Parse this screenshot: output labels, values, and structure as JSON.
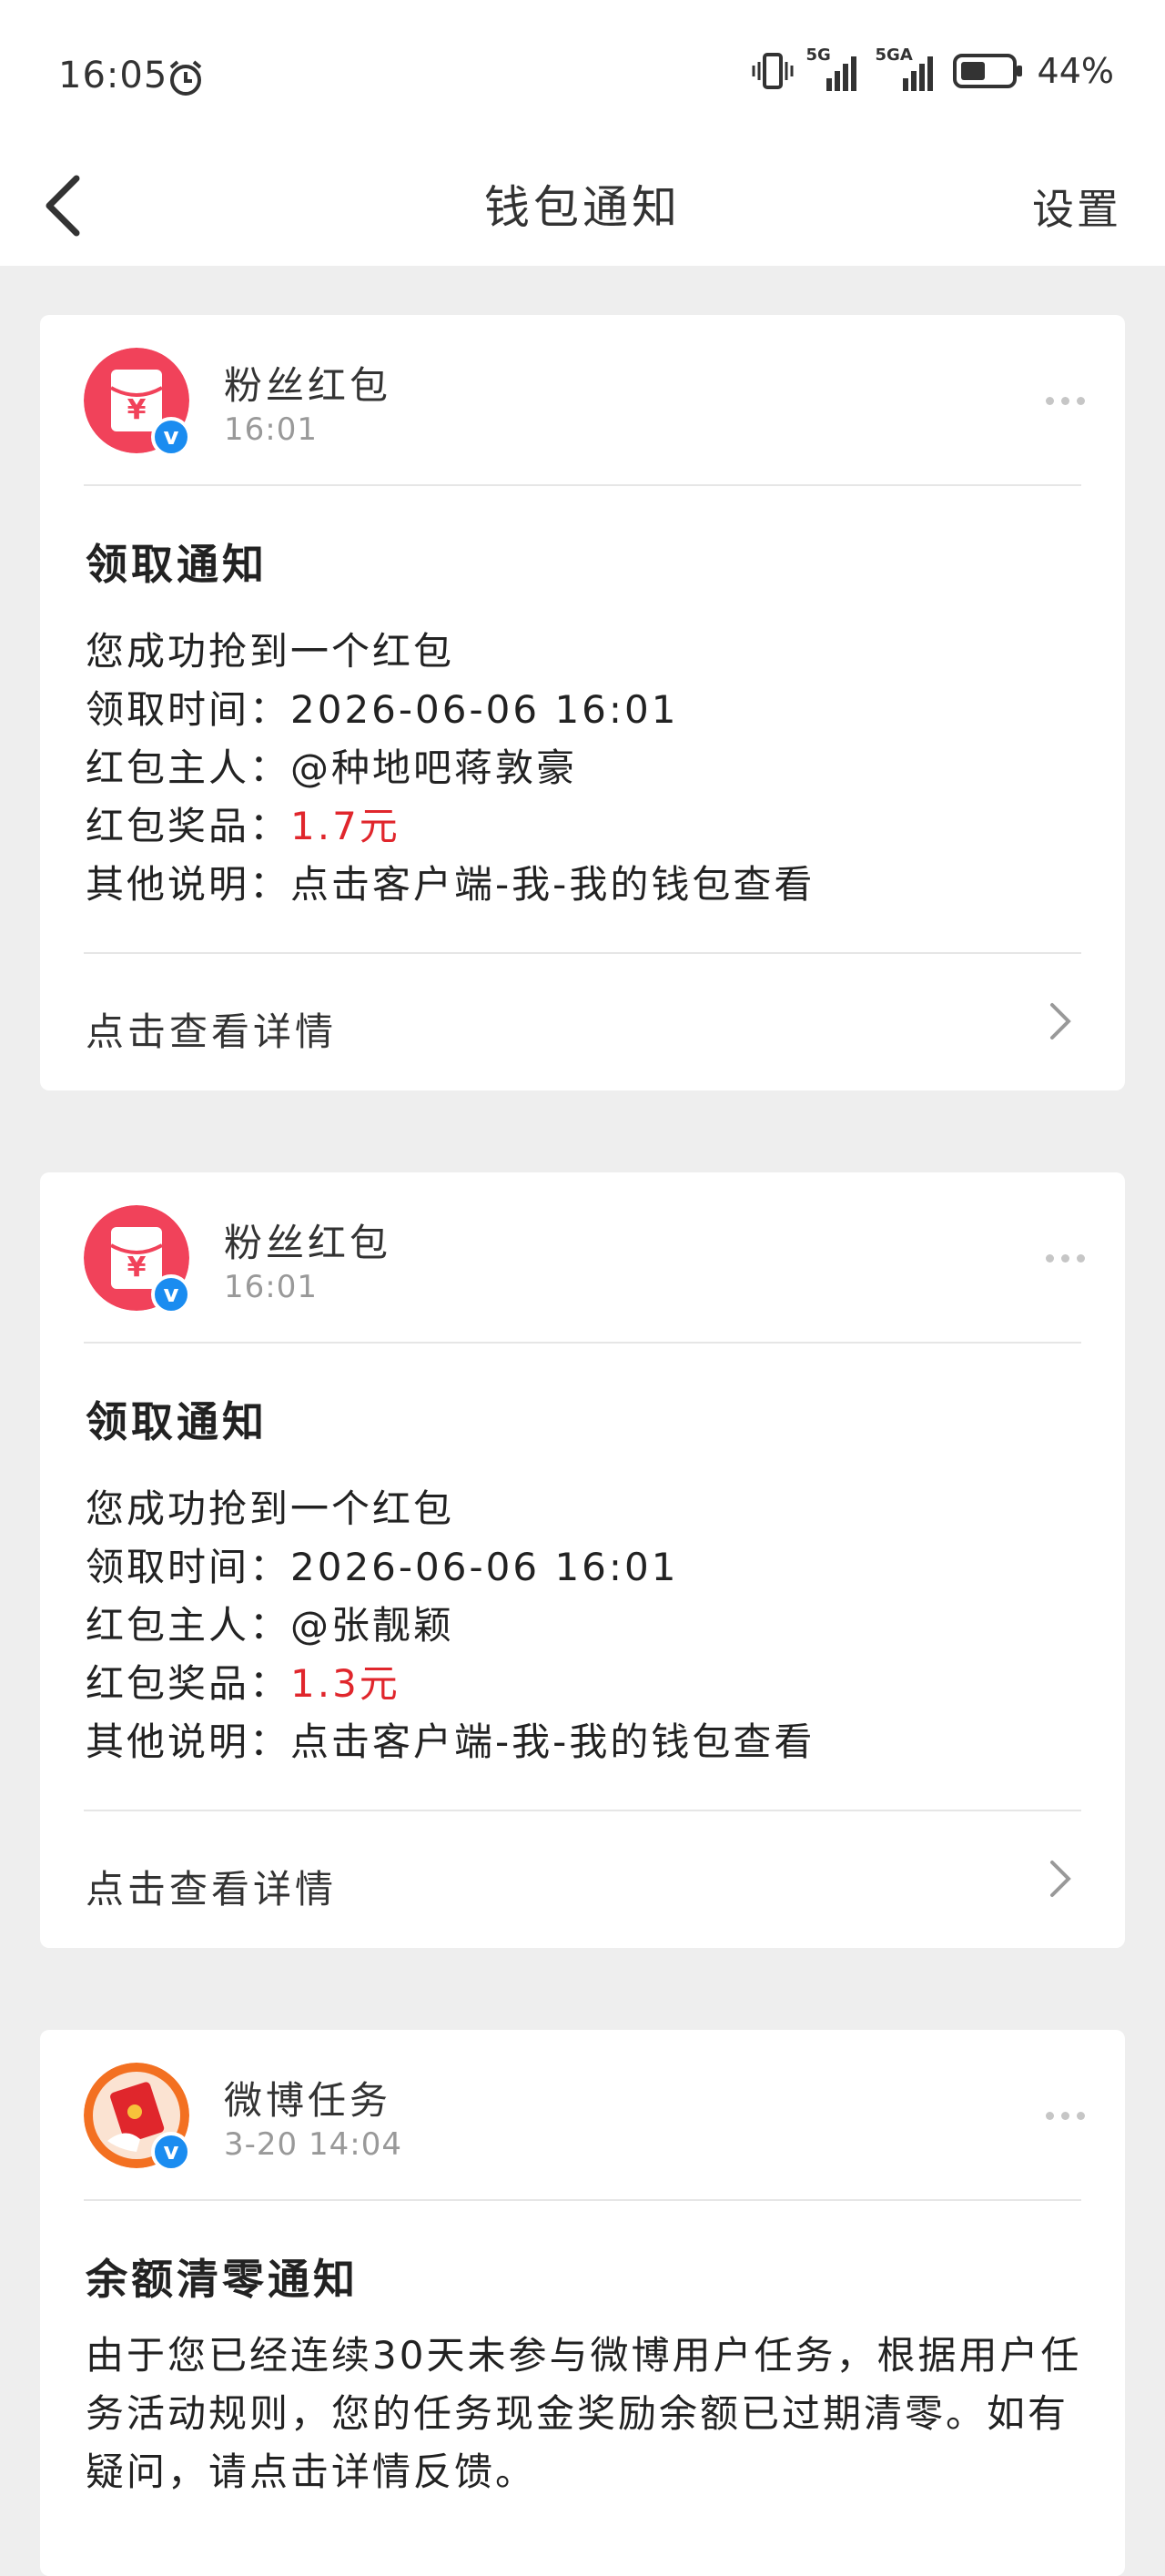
{
  "status_bar": {
    "time": "16:05",
    "net1": "5G",
    "net2": "5GA",
    "battery": "44%"
  },
  "nav": {
    "title": "钱包通知",
    "settings": "设置"
  },
  "cards": [
    {
      "sender": "粉丝红包",
      "time": "16:01",
      "title": "领取通知",
      "line1": "您成功抢到一个红包",
      "line2_label": "领取时间：",
      "line2_value": "2026-06-06 16:01",
      "line3_label": "红包主人：",
      "line3_value": "@种地吧蒋敦豪",
      "line4_label": "红包奖品：",
      "line4_value": "1.7元",
      "line5_label": "其他说明：",
      "line5_value": "点击客户端-我-我的钱包查看",
      "details": "点击查看详情"
    },
    {
      "sender": "粉丝红包",
      "time": "16:01",
      "title": "领取通知",
      "line1": "您成功抢到一个红包",
      "line2_label": "领取时间：",
      "line2_value": "2026-06-06 16:01",
      "line3_label": "红包主人：",
      "line3_value": "@张靓颖",
      "line4_label": "红包奖品：",
      "line4_value": "1.3元",
      "line5_label": "其他说明：",
      "line5_value": "点击客户端-我-我的钱包查看",
      "details": "点击查看详情"
    },
    {
      "sender": "微博任务",
      "time": "3-20 14:04",
      "title": "余额清零通知",
      "body": "由于您已经连续30天未参与微博用户任务，根据用户任务活动规则，您的任务现金奖励余额已过期清零。如有疑问，请点击详情反馈。"
    }
  ],
  "colors": {
    "accent_red": "#e0262c",
    "verified_blue": "#1a8cf0",
    "avatar_red": "#f1425a",
    "avatar_orange": "#f37021"
  }
}
